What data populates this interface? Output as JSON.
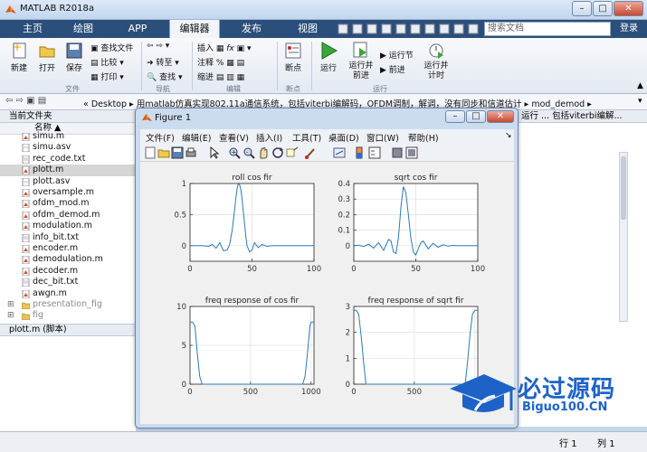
{
  "app": {
    "title": "MATLAB R2018a",
    "login": "登录",
    "search_placeholder": "搜索文档"
  },
  "tabs": [
    "主页",
    "绘图",
    "APP",
    "编辑器",
    "发布",
    "视图"
  ],
  "ribbon": {
    "file_group": {
      "new": "新建",
      "open": "打开",
      "save": "保存",
      "find_files": "查找文件",
      "compare": "比较",
      "print": "打印",
      "label": "文件"
    },
    "nav_group": {
      "goto": "转至",
      "find": "查找",
      "label": "导航"
    },
    "edit_group": {
      "insert": "插入",
      "comment": "注释",
      "indent": "缩进",
      "label": "编辑"
    },
    "breakpoint_group": {
      "breakpoints": "断点",
      "label": "断点"
    },
    "run_group": {
      "run": "运行",
      "run_advance": "运行并\n前进",
      "run_section": "运行节",
      "advance": "前进",
      "run_time": "运行并\n计时",
      "label": "运行"
    }
  },
  "address": {
    "path": "« Desktop ▸ 用matlab仿真实现802.11a通信系统，包括viterbi编解码，OFDM调制，解调，没有同步和信道估计 ▸ mod_demod ▸"
  },
  "file_panel": {
    "header": "当前文件夹",
    "col_name": "名称 ▲",
    "files": [
      {
        "name": "simu.m",
        "type": "m"
      },
      {
        "name": "simu.asv",
        "type": "asv"
      },
      {
        "name": "rec_code.txt",
        "type": "txt"
      },
      {
        "name": "plott.m",
        "type": "m"
      },
      {
        "name": "plott.asv",
        "type": "asv"
      },
      {
        "name": "oversample.m",
        "type": "m"
      },
      {
        "name": "ofdm_mod.m",
        "type": "m"
      },
      {
        "name": "ofdm_demod.m",
        "type": "m"
      },
      {
        "name": "modulation.m",
        "type": "m"
      },
      {
        "name": "info_bit.txt",
        "type": "txt"
      },
      {
        "name": "encoder.m",
        "type": "m"
      },
      {
        "name": "demodulation.m",
        "type": "m"
      },
      {
        "name": "decoder.m",
        "type": "m"
      },
      {
        "name": "dec_bit.txt",
        "type": "txt"
      },
      {
        "name": "awgn.m",
        "type": "m"
      },
      {
        "name": "presentation_fig",
        "type": "folder"
      },
      {
        "name": "fig",
        "type": "folder"
      }
    ],
    "footer": "plott.m  (脚本)"
  },
  "right_panel": {
    "header": "运行 ... 包括viterbi编解..."
  },
  "status": {
    "row_label": "行",
    "row_value": "1",
    "col_label": "列",
    "col_value": "1"
  },
  "figure": {
    "title": "Figure 1",
    "menu": [
      "文件(F)",
      "编辑(E)",
      "查看(V)",
      "插入(I)",
      "工具(T)",
      "桌面(D)",
      "窗口(W)",
      "帮助(H)"
    ]
  },
  "watermark": {
    "main": "必过源码",
    "sub": "Biguo100.CN"
  },
  "colors": {
    "line": "#2a7ab8",
    "ribbon_tab": "#2b4f7a"
  },
  "chart_data": [
    {
      "type": "line",
      "title": "roll cos fir",
      "xlim": [
        0,
        100
      ],
      "ylim": [
        -0.25,
        1
      ],
      "xticks": [
        0,
        50,
        100
      ],
      "yticks": [
        0,
        0.5,
        1
      ],
      "grid": true,
      "x": [
        0,
        5,
        10,
        15,
        18,
        21,
        24,
        27,
        30,
        32,
        34,
        36,
        37,
        38,
        39,
        40,
        41,
        42,
        43,
        44,
        45,
        46,
        48,
        50,
        52,
        55,
        58,
        62,
        66,
        70,
        75,
        80,
        85,
        90,
        95,
        100
      ],
      "series": [
        {
          "values": [
            0,
            0,
            0,
            -0.01,
            0.02,
            -0.04,
            0.05,
            -0.08,
            -0.07,
            0.02,
            0.25,
            0.58,
            0.77,
            0.92,
            1.0,
            0.98,
            0.9,
            0.75,
            0.55,
            0.35,
            0.15,
            0.0,
            -0.1,
            -0.07,
            0.05,
            -0.03,
            0.02,
            -0.01,
            0,
            0,
            0,
            0,
            0,
            0,
            0,
            0
          ]
        }
      ]
    },
    {
      "type": "line",
      "title": "sqrt cos fir",
      "xlim": [
        0,
        100
      ],
      "ylim": [
        -0.1,
        0.4
      ],
      "xticks": [
        0,
        50,
        100
      ],
      "yticks": [
        0,
        0.1,
        0.2,
        0.3,
        0.4
      ],
      "grid": true,
      "x": [
        0,
        4,
        8,
        12,
        16,
        20,
        24,
        28,
        30,
        32,
        34,
        36,
        38,
        40,
        42,
        44,
        46,
        48,
        50,
        52,
        54,
        56,
        60,
        64,
        68,
        72,
        76,
        80,
        84,
        88,
        92,
        96,
        100
      ],
      "series": [
        {
          "values": [
            0,
            0.003,
            -0.005,
            0.01,
            -0.015,
            0.02,
            -0.03,
            0.04,
            0.03,
            -0.04,
            -0.05,
            0.05,
            0.25,
            0.38,
            0.34,
            0.2,
            0.05,
            -0.04,
            -0.06,
            -0.02,
            0.02,
            0.03,
            -0.02,
            0.015,
            -0.01,
            0.006,
            -0.003,
            0.002,
            0,
            0,
            0,
            0,
            0
          ]
        }
      ]
    },
    {
      "type": "line",
      "title": "freq response of cos fir",
      "xlim": [
        0,
        1024
      ],
      "ylim": [
        0,
        10
      ],
      "xticks": [
        0,
        500,
        1000
      ],
      "yticks": [
        0,
        5,
        10
      ],
      "grid": true,
      "x": [
        0,
        20,
        40,
        60,
        80,
        100,
        120,
        500,
        900,
        930,
        950,
        970,
        990,
        1000,
        1024
      ],
      "series": [
        {
          "values": [
            8,
            8,
            7.5,
            4,
            1,
            0,
            0,
            0,
            0,
            0,
            1,
            4,
            7.5,
            8,
            8
          ]
        }
      ]
    },
    {
      "type": "line",
      "title": "freq response of sqrt fir",
      "xlim": [
        0,
        1024
      ],
      "ylim": [
        0,
        3
      ],
      "xticks": [
        0,
        500,
        1000
      ],
      "yticks": [
        0,
        1,
        2,
        3
      ],
      "grid": true,
      "x": [
        0,
        20,
        40,
        60,
        80,
        100,
        120,
        500,
        900,
        920,
        940,
        960,
        980,
        1000,
        1024
      ],
      "series": [
        {
          "values": [
            2.85,
            2.85,
            2.7,
            1.9,
            0.9,
            0,
            0,
            0,
            0,
            0,
            0.9,
            1.9,
            2.7,
            2.85,
            2.85
          ]
        }
      ]
    }
  ]
}
